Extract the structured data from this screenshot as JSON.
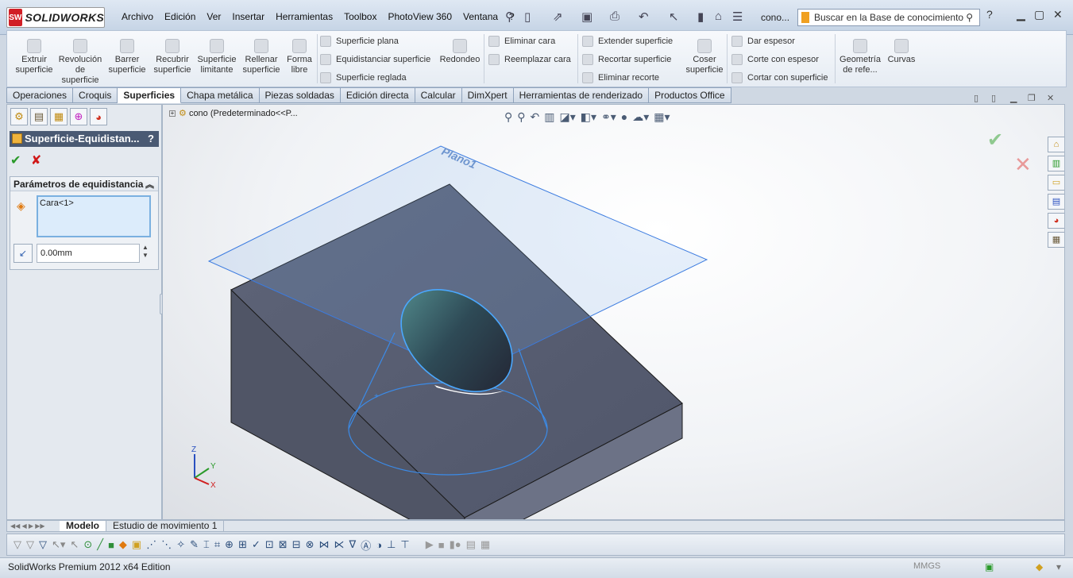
{
  "app": {
    "brand": "SOLIDWORKS",
    "logo_badge": "SW",
    "document": "cono...",
    "search_placeholder": "Buscar en la Base de conocimiento"
  },
  "menu": [
    "Archivo",
    "Edición",
    "Ver",
    "Insertar",
    "Herramientas",
    "Toolbox",
    "PhotoView 360",
    "Ventana",
    "?"
  ],
  "command_manager": {
    "big_buttons": [
      {
        "label": "Extruir superficie",
        "icon": "extrude-surface-icon"
      },
      {
        "label": "Revolución de superficie",
        "icon": "revolve-surface-icon"
      },
      {
        "label": "Barrer superficie",
        "icon": "sweep-surface-icon"
      },
      {
        "label": "Recubrir superficie",
        "icon": "loft-surface-icon"
      },
      {
        "label": "Superficie limitante",
        "icon": "boundary-surface-icon"
      },
      {
        "label": "Rellenar superficie",
        "icon": "fill-surface-icon"
      },
      {
        "label": "Forma libre",
        "icon": "freeform-icon"
      },
      {
        "label": "Redondeo",
        "icon": "fillet-icon"
      },
      {
        "label": "Coser superficie",
        "icon": "knit-surface-icon"
      },
      {
        "label": "Geometría de refe...",
        "icon": "reference-geometry-icon"
      },
      {
        "label": "Curvas",
        "icon": "curves-icon"
      }
    ],
    "small_col1": [
      "Superficie plana",
      "Equidistanciar superficie",
      "Superficie reglada"
    ],
    "small_col2": [
      "Eliminar cara",
      "Reemplazar cara"
    ],
    "small_col3": [
      "Extender superficie",
      "Recortar superficie",
      "Eliminar recorte"
    ],
    "small_col4": [
      "Dar espesor",
      "Corte con espesor",
      "Cortar con superficie"
    ]
  },
  "tabs": [
    "Operaciones",
    "Croquis",
    "Superficies",
    "Chapa metálica",
    "Piezas soldadas",
    "Edición directa",
    "Calcular",
    "DimXpert",
    "Herramientas de renderizado",
    "Productos Office"
  ],
  "active_tab": "Superficies",
  "panel": {
    "title": "Superficie-Equidistan...",
    "help": "?",
    "group_title": "Parámetros de equidistancia",
    "selection": "Cara<1>",
    "distance": "0.00mm"
  },
  "viewport": {
    "tree_node": "cono  (Predeterminado<<P...",
    "plane_label": "Plano1",
    "axes": [
      "Z",
      "Y",
      "X"
    ]
  },
  "bottom_tabs": [
    "Modelo",
    "Estudio de movimiento 1"
  ],
  "status": {
    "edition": "SolidWorks Premium 2012 x64 Edition",
    "units": "MMGS"
  },
  "colors": {
    "accent": "#4a5a73",
    "plane": "#3b7be0",
    "solid": "#565c6e",
    "face": "#4f8a8d"
  }
}
